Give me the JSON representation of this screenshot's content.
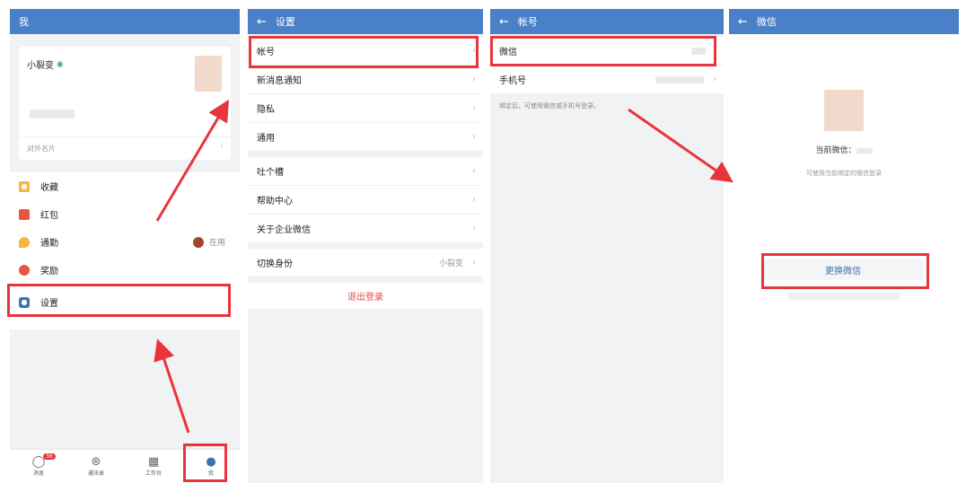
{
  "panel1": {
    "title": "我",
    "profile": {
      "name": "小裂变",
      "card_label": "对外名片"
    },
    "menu": [
      {
        "label": "收藏",
        "icon": "favorites-icon",
        "color": "#f6b73c"
      },
      {
        "label": "红包",
        "icon": "red-packet-icon",
        "color": "#e8563f"
      },
      {
        "label": "通勤",
        "icon": "commute-pin-icon",
        "color": "#f6b73c",
        "status": "在用"
      },
      {
        "label": "奖励",
        "icon": "reward-medal-icon",
        "color": "#e8563f"
      },
      {
        "label": "设置",
        "icon": "settings-gear-icon",
        "color": "#3e6fb0"
      }
    ],
    "tabs": [
      {
        "label": "消息",
        "badge": "36",
        "icon": "chat-bubble-icon"
      },
      {
        "label": "通讯录",
        "icon": "contacts-tree-icon"
      },
      {
        "label": "工作台",
        "icon": "workbench-grid-icon"
      },
      {
        "label": "我",
        "icon": "person-icon",
        "active": true
      }
    ]
  },
  "panel2": {
    "title": "设置",
    "groups": [
      [
        {
          "label": "帐号"
        },
        {
          "label": "新消息通知"
        },
        {
          "label": "隐私"
        },
        {
          "label": "通用"
        }
      ],
      [
        {
          "label": "吐个槽"
        },
        {
          "label": "帮助中心"
        },
        {
          "label": "关于企业微信"
        }
      ],
      [
        {
          "label": "切换身份",
          "value": "小裂变"
        }
      ]
    ],
    "logout": "退出登录"
  },
  "panel3": {
    "title": "帐号",
    "rows": [
      {
        "label": "微信"
      },
      {
        "label": "手机号"
      }
    ],
    "hint": "绑定后，可使用微信或手机号登录。"
  },
  "panel4": {
    "title": "微信",
    "current_label": "当前微信：",
    "hint": "可使用当前绑定的微信登录",
    "button": "更换微信"
  },
  "colors": {
    "header": "#4a80c7",
    "highlight": "#e8353b",
    "logout": "#e04a3f",
    "link": "#3e6fb0"
  }
}
